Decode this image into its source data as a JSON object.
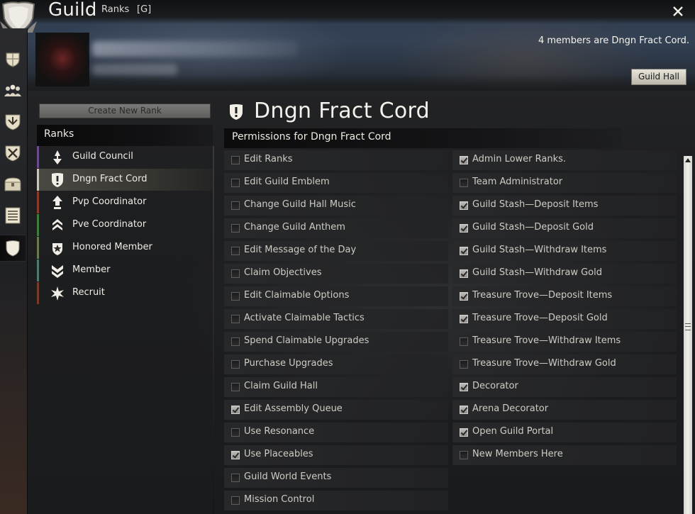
{
  "window": {
    "title": "Guild",
    "tabs": [
      "Ranks",
      "[G]"
    ],
    "close_icon": "close-icon"
  },
  "sidebar_rail": {
    "items": [
      {
        "icon": "guild-shield-icon",
        "active": false
      },
      {
        "icon": "members-icon",
        "active": false
      },
      {
        "icon": "guild-emblem-icon",
        "active": false
      },
      {
        "icon": "crossed-swords-icon",
        "active": false
      },
      {
        "icon": "treasure-chest-icon",
        "active": false
      },
      {
        "icon": "log-list-icon",
        "active": false
      },
      {
        "icon": "ranks-shield-icon",
        "active": true
      }
    ]
  },
  "guild_info": {
    "members_note": "4 members are Dngn Fract Cord.",
    "guild_hall_label": "Guild Hall"
  },
  "ranks_panel": {
    "create_label": "Create New Rank",
    "header": "Ranks",
    "items": [
      {
        "label": "Guild Council",
        "icon": "council-rank-icon",
        "bar_color": "#6a4b8c",
        "selected": false
      },
      {
        "label": "Dngn Fract Cord",
        "icon": "shield-exclaim-rank-icon",
        "bar_color": "#c9c7c0",
        "selected": true
      },
      {
        "label": "Pvp Coordinator",
        "icon": "arrow-up-rank-icon",
        "bar_color": "#8a3b2b",
        "selected": false
      },
      {
        "label": "Pve Coordinator",
        "icon": "double-chevron-rank-icon",
        "bar_color": "#3f7a3f",
        "selected": false
      },
      {
        "label": "Honored Member",
        "icon": "medal-rank-icon",
        "bar_color": "#6a7a52",
        "selected": false
      },
      {
        "label": "Member",
        "icon": "chevron-rank-icon",
        "bar_color": "#4d7a6a",
        "selected": false
      },
      {
        "label": "Recruit",
        "icon": "star-burst-rank-icon",
        "bar_color": "#7a3a2a",
        "selected": false
      }
    ]
  },
  "rank_detail": {
    "title": "Dngn Fract Cord",
    "permissions_header": "Permissions for Dngn Fract Cord",
    "left_permissions": [
      {
        "label": "Edit Ranks",
        "checked": false
      },
      {
        "label": "Edit Guild Emblem",
        "checked": false
      },
      {
        "label": "Change Guild Hall Music",
        "checked": false
      },
      {
        "label": "Change Guild Anthem",
        "checked": false
      },
      {
        "label": "Edit Message of the Day",
        "checked": false
      },
      {
        "label": "Claim Objectives",
        "checked": false
      },
      {
        "label": "Edit Claimable Options",
        "checked": false
      },
      {
        "label": "Activate Claimable Tactics",
        "checked": false
      },
      {
        "label": "Spend Claimable Upgrades",
        "checked": false
      },
      {
        "label": "Purchase Upgrades",
        "checked": false
      },
      {
        "label": "Claim Guild Hall",
        "checked": false
      },
      {
        "label": "Edit Assembly Queue",
        "checked": true
      },
      {
        "label": "Use Resonance",
        "checked": false
      },
      {
        "label": "Use Placeables",
        "checked": true
      },
      {
        "label": "Guild World Events",
        "checked": false
      },
      {
        "label": "Mission Control",
        "checked": false
      }
    ],
    "right_permissions": [
      {
        "label": "Admin Lower Ranks.",
        "checked": true
      },
      {
        "label": "Team Administrator",
        "checked": false
      },
      {
        "label": "Guild Stash—Deposit Items",
        "checked": true
      },
      {
        "label": "Guild Stash—Deposit Gold",
        "checked": true
      },
      {
        "label": "Guild Stash—Withdraw Items",
        "checked": true
      },
      {
        "label": "Guild Stash—Withdraw Gold",
        "checked": true
      },
      {
        "label": "Treasure Trove—Deposit Items",
        "checked": true
      },
      {
        "label": "Treasure Trove—Deposit Gold",
        "checked": true
      },
      {
        "label": "Treasure Trove—Withdraw Items",
        "checked": false
      },
      {
        "label": "Treasure Trove—Withdraw Gold",
        "checked": false
      },
      {
        "label": "Decorator",
        "checked": true
      },
      {
        "label": "Arena Decorator",
        "checked": true
      },
      {
        "label": "Open Guild Portal",
        "checked": true
      },
      {
        "label": "New Members Here",
        "checked": false
      }
    ]
  }
}
